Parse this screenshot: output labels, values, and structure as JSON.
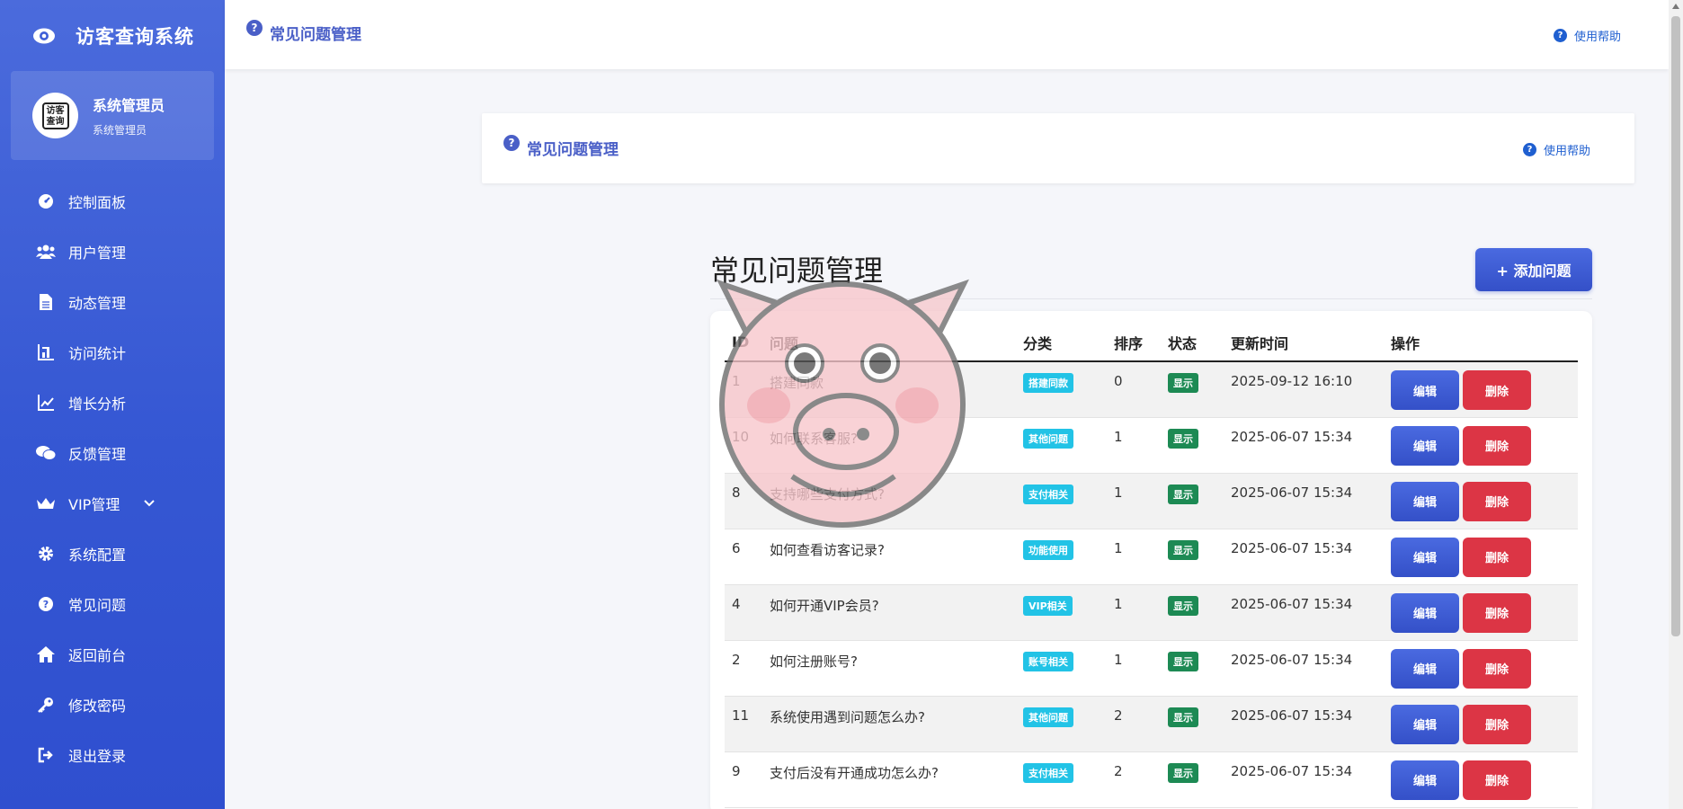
{
  "app": {
    "title": "访客查询系统"
  },
  "profile": {
    "name": "系统管理员",
    "role": "系统管理员",
    "avatar_text": "访客查询"
  },
  "sidebar": {
    "items": [
      {
        "label": "控制面板",
        "icon": "dashboard-icon"
      },
      {
        "label": "用户管理",
        "icon": "users-icon"
      },
      {
        "label": "动态管理",
        "icon": "document-icon"
      },
      {
        "label": "访问统计",
        "icon": "bar-chart-icon"
      },
      {
        "label": "增长分析",
        "icon": "line-chart-icon"
      },
      {
        "label": "反馈管理",
        "icon": "comments-icon"
      },
      {
        "label": "VIP管理",
        "icon": "crown-icon"
      },
      {
        "label": "系统配置",
        "icon": "gear-icon"
      },
      {
        "label": "常见问题",
        "icon": "question-circle-icon"
      },
      {
        "label": "返回前台",
        "icon": "home-icon"
      },
      {
        "label": "修改密码",
        "icon": "key-icon"
      },
      {
        "label": "退出登录",
        "icon": "logout-icon"
      }
    ]
  },
  "topbar": {
    "title": "常见问题管理",
    "help": "使用帮助"
  },
  "header_card": {
    "title": "常见问题管理",
    "help": "使用帮助"
  },
  "main": {
    "heading": "常见问题管理",
    "add_button": "+ 添加问题"
  },
  "table": {
    "columns": [
      "ID",
      "问题",
      "分类",
      "排序",
      "状态",
      "更新时间",
      "操作"
    ],
    "rows": [
      {
        "id": "1",
        "question": "搭建同款",
        "category": "搭建同款",
        "sort": "0",
        "status": "显示",
        "updated": "2025-09-12 16:10"
      },
      {
        "id": "10",
        "question": "如何联系客服?",
        "category": "其他问题",
        "sort": "1",
        "status": "显示",
        "updated": "2025-06-07 15:34"
      },
      {
        "id": "8",
        "question": "支持哪些支付方式?",
        "category": "支付相关",
        "sort": "1",
        "status": "显示",
        "updated": "2025-06-07 15:34"
      },
      {
        "id": "6",
        "question": "如何查看访客记录?",
        "category": "功能使用",
        "sort": "1",
        "status": "显示",
        "updated": "2025-06-07 15:34"
      },
      {
        "id": "4",
        "question": "如何开通VIP会员?",
        "category": "VIP相关",
        "sort": "1",
        "status": "显示",
        "updated": "2025-06-07 15:34"
      },
      {
        "id": "2",
        "question": "如何注册账号?",
        "category": "账号相关",
        "sort": "1",
        "status": "显示",
        "updated": "2025-06-07 15:34"
      },
      {
        "id": "11",
        "question": "系统使用遇到问题怎么办?",
        "category": "其他问题",
        "sort": "2",
        "status": "显示",
        "updated": "2025-06-07 15:34"
      },
      {
        "id": "9",
        "question": "支付后没有开通成功怎么办?",
        "category": "支付相关",
        "sort": "2",
        "status": "显示",
        "updated": "2025-06-07 15:34"
      }
    ],
    "edit_label": "编辑",
    "delete_label": "删除"
  },
  "colors": {
    "sidebar": "#3557d3",
    "accent": "#4a5fc7",
    "danger": "#dc3545",
    "info": "#22c3e6",
    "success": "#1d8a54"
  }
}
